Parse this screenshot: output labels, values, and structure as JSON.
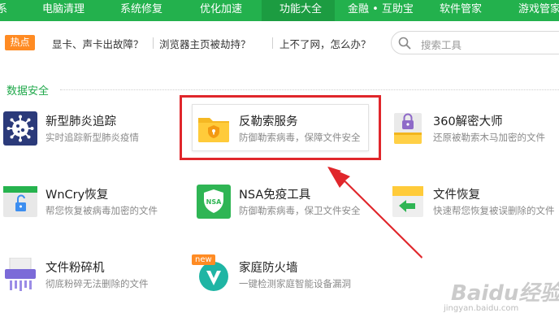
{
  "topnav": {
    "tabs": [
      {
        "label": "系"
      },
      {
        "label": "电脑清理"
      },
      {
        "label": "系统修复"
      },
      {
        "label": "优化加速"
      },
      {
        "label": "功能大全"
      },
      {
        "label": "金融 • 互助宝"
      },
      {
        "label": "软件管家"
      },
      {
        "label": "游戏管家"
      }
    ],
    "active_index": 4,
    "colors": {
      "bar": "#23b14d",
      "active": "#1c9c41"
    }
  },
  "hotbar": {
    "badge": "热点",
    "links": [
      "显卡、声卡出故障？",
      "浏览器主页被劫持？",
      "上不了网，怎么办？"
    ]
  },
  "search": {
    "placeholder": "搜索工具"
  },
  "section": {
    "title": "数据安全"
  },
  "tools": [
    {
      "name": "新型肺炎追踪",
      "desc": "实时追踪新型肺炎疫情",
      "icon": "virus-icon"
    },
    {
      "name": "反勒索服务",
      "desc": "防御勒索病毒，保障文件安全",
      "icon": "shield-folder-icon"
    },
    {
      "name": "360解密大师",
      "desc": "还原被勒索木马加密的文件",
      "icon": "lock-box-icon"
    },
    {
      "name": "WnCry恢复",
      "desc": "帮您恢复被病毒加密的文件",
      "icon": "unlock-window-icon"
    },
    {
      "name": "NSA免疫工具",
      "desc": "防御勒索病毒，保卫文件安全",
      "icon": "nsa-shield-icon"
    },
    {
      "name": "文件恢复",
      "desc": "快速帮您恢复被误删除的文件",
      "icon": "file-restore-icon"
    },
    {
      "name": "文件粉碎机",
      "desc": "彻底粉碎无法删除的文件",
      "icon": "shredder-icon"
    },
    {
      "name": "家庭防火墙",
      "desc": "一键检测家庭智能设备漏洞",
      "icon": "home-firewall-icon",
      "badge": "new"
    }
  ],
  "watermark": {
    "text": "Baidu经验",
    "sub": "jingyan.baidu.com"
  }
}
